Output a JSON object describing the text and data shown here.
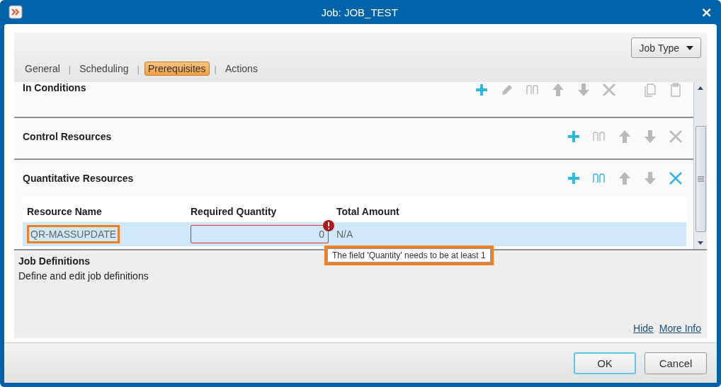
{
  "window": {
    "title": "Job: JOB_TEST",
    "close_glyph": "×"
  },
  "job_type_button": {
    "label": "Job Type"
  },
  "tabs": [
    {
      "label": "General",
      "selected": false
    },
    {
      "separator_before": "|",
      "label": "Scheduling",
      "selected": false
    },
    {
      "separator_before": "|",
      "label": "Prerequisites",
      "selected": true
    },
    {
      "separator_before": "|",
      "label": "Actions",
      "selected": false
    }
  ],
  "sections": [
    {
      "title": "In Conditions",
      "tools": [
        {
          "kind": "add",
          "enabled": true
        },
        {
          "kind": "edit",
          "enabled": false
        },
        {
          "kind": "link",
          "enabled": false
        },
        {
          "kind": "up",
          "enabled": false
        },
        {
          "kind": "down",
          "enabled": false
        },
        {
          "kind": "delete",
          "enabled": false
        },
        {
          "kind": "copy",
          "enabled": false
        },
        {
          "kind": "paste",
          "enabled": false
        }
      ]
    },
    {
      "title": "Control Resources",
      "tools": [
        {
          "kind": "add",
          "enabled": true
        },
        {
          "kind": "link",
          "enabled": false
        },
        {
          "kind": "up",
          "enabled": false
        },
        {
          "kind": "down",
          "enabled": false
        },
        {
          "kind": "delete",
          "enabled": false
        }
      ]
    },
    {
      "title": "Quantitative Resources",
      "tools": [
        {
          "kind": "add",
          "enabled": true
        },
        {
          "kind": "link",
          "enabled": true
        },
        {
          "kind": "up",
          "enabled": false
        },
        {
          "kind": "down",
          "enabled": false
        },
        {
          "kind": "delete",
          "enabled": true
        }
      ],
      "table": {
        "columns": [
          "Resource Name",
          "Required Quantity",
          "Total Amount"
        ],
        "rows": [
          {
            "selected": true,
            "resource_name": "QR-MASSUPDATE",
            "resource_name_highlighted": true,
            "required_quantity": "0",
            "invalid": true,
            "total_amount": "N/A"
          }
        ]
      }
    }
  ],
  "tooltip": {
    "text": "The field 'Quantity' needs to be at least 1",
    "highlighted": true
  },
  "info_panel": {
    "title": "Job Definitions",
    "description": "Define and edit job definitions",
    "links": [
      "Hide",
      "More Info"
    ]
  },
  "buttons": [
    {
      "label": "OK",
      "focused": true
    },
    {
      "label": "Cancel",
      "focused": false
    }
  ]
}
